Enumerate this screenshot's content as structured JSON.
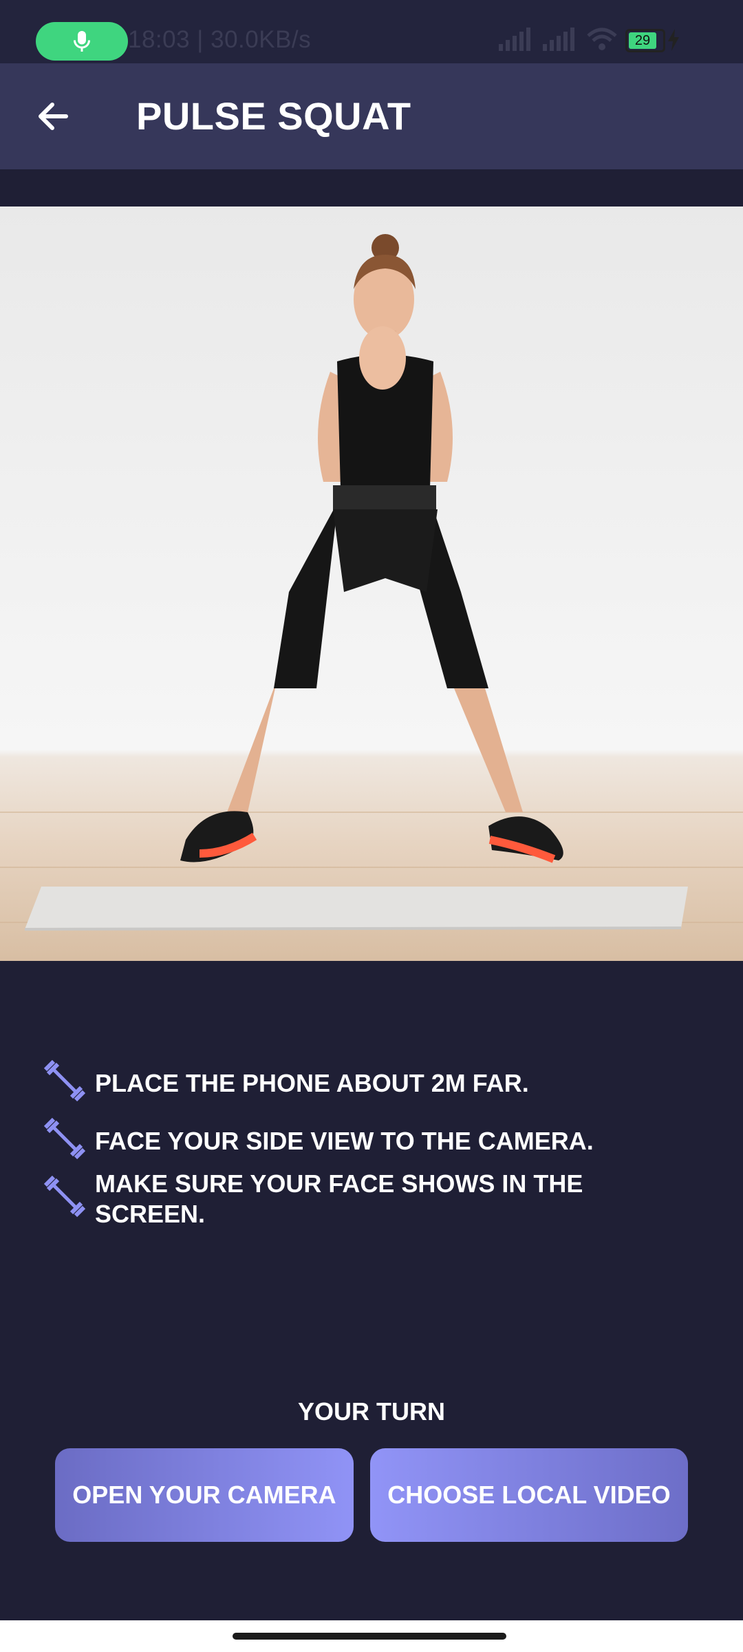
{
  "status_bar": {
    "text": "18:03 | 30.0KB/s",
    "battery_level": "29",
    "icons": [
      "mic-icon",
      "signal-icon",
      "signal-icon",
      "wifi-icon",
      "battery-icon",
      "charging-icon"
    ]
  },
  "header": {
    "title": "PULSE SQUAT",
    "back_icon": "arrow-left-icon"
  },
  "instructions": [
    {
      "icon": "dumbbell-icon",
      "text": "PLACE THE PHONE ABOUT 2M FAR."
    },
    {
      "icon": "dumbbell-icon",
      "text": "FACE YOUR SIDE VIEW TO THE CAMERA."
    },
    {
      "icon": "dumbbell-icon",
      "text": "MAKE SURE YOUR FACE SHOWS IN THE SCREEN."
    }
  ],
  "your_turn": "YOUR TURN",
  "buttons": {
    "camera": "OPEN YOUR CAMERA",
    "local_video": "CHOOSE LOCAL VIDEO"
  },
  "colors": {
    "background": "#1f1f35",
    "app_bar": "#36375a",
    "accent": "#8e91f3",
    "mic_pill": "#3fd57f"
  }
}
